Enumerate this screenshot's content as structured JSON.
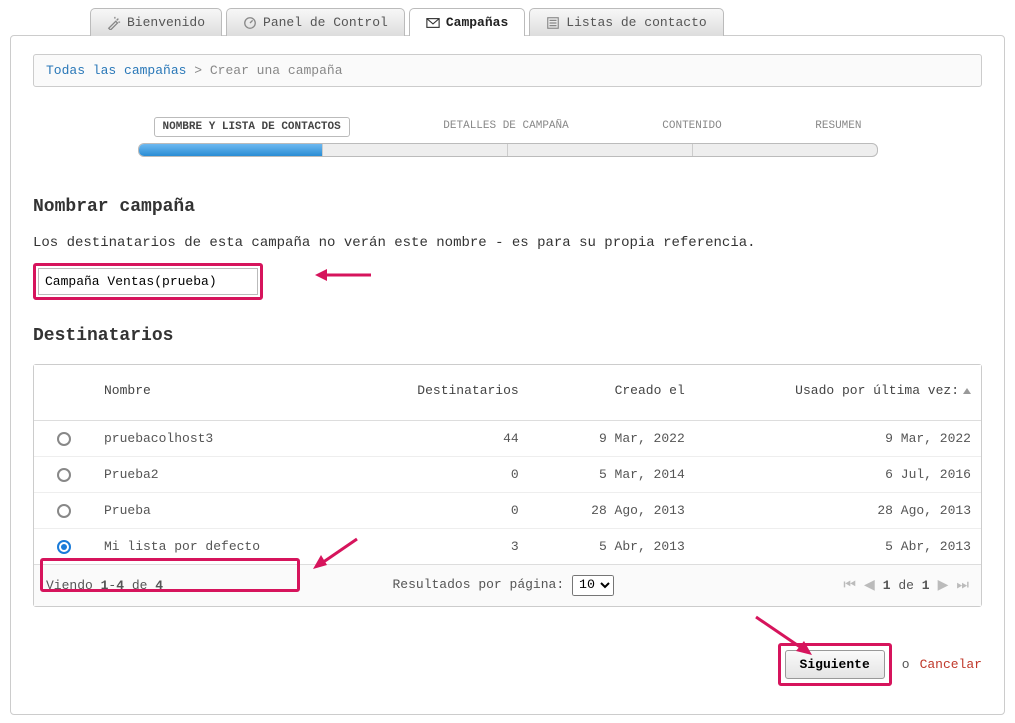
{
  "tabs": [
    {
      "label": "Bienvenido",
      "icon": "wand-icon"
    },
    {
      "label": "Panel de Control",
      "icon": "gauge-icon"
    },
    {
      "label": "Campañas",
      "icon": "mail-icon",
      "active": true
    },
    {
      "label": "Listas de contacto",
      "icon": "list-icon"
    }
  ],
  "breadcrumb": {
    "root": "Todas las campañas",
    "separator": ">",
    "current": "Crear una campaña"
  },
  "wizard": {
    "steps": [
      "NOMBRE Y LISTA DE CONTACTOS",
      "DETALLES DE CAMPAÑA",
      "CONTENIDO",
      "RESUMEN"
    ],
    "active_index": 0
  },
  "name_section": {
    "title": "Nombrar campaña",
    "hint": "Los destinatarios de esta campaña no verán este nombre - es para su propia referencia.",
    "value": "Campaña Ventas(prueba)"
  },
  "recipients_section": {
    "title": "Destinatarios",
    "columns": {
      "name": "Nombre",
      "recipients": "Destinatarios",
      "created": "Creado el",
      "last_used": "Usado por última vez:"
    },
    "rows": [
      {
        "name": "pruebacolhost3",
        "recipients": "44",
        "created": "9 Mar, 2022",
        "last_used": "9 Mar, 2022",
        "selected": false
      },
      {
        "name": "Prueba2",
        "recipients": "0",
        "created": "5 Mar, 2014",
        "last_used": "6 Jul, 2016",
        "selected": false
      },
      {
        "name": "Prueba",
        "recipients": "0",
        "created": "28 Ago, 2013",
        "last_used": "28 Ago, 2013",
        "selected": false
      },
      {
        "name": "Mi lista por defecto",
        "recipients": "3",
        "created": "5 Abr, 2013",
        "last_used": "5 Abr, 2013",
        "selected": true
      }
    ],
    "footer": {
      "viewing_text": "Viendo 1-4 de 4",
      "per_page_label": "Resultados por página:",
      "per_page_value": "10",
      "page_text": "1 de 1"
    }
  },
  "actions": {
    "next": "Siguiente",
    "or": "o",
    "cancel": "Cancelar"
  }
}
